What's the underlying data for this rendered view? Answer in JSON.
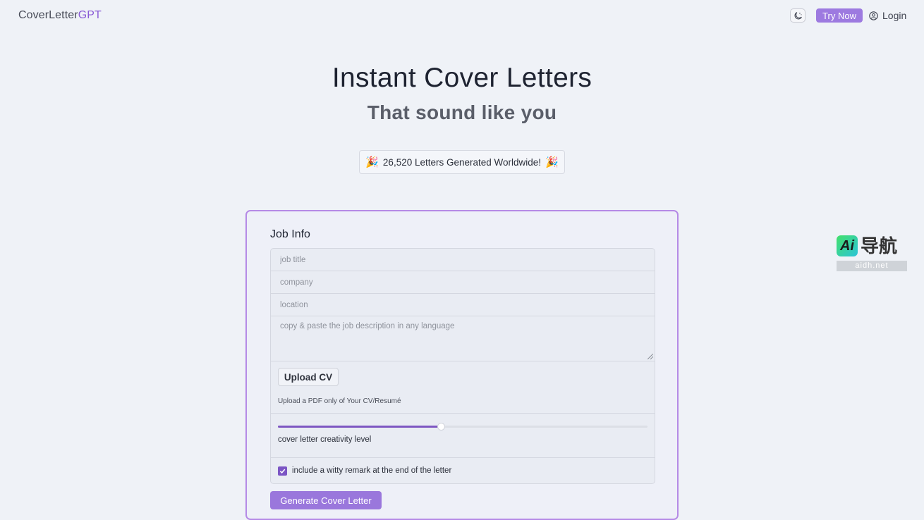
{
  "header": {
    "logo_prefix": "CoverLetter",
    "logo_accent": "GPT",
    "theme_toggle_icon": "moon-stars-icon",
    "try_now_label": "Try Now",
    "login_label": "Login",
    "login_icon": "user-circle-icon"
  },
  "hero": {
    "title": "Instant Cover Letters",
    "subtitle": "That sound like you",
    "counter_text": "26,520 Letters Generated Worldwide!",
    "counter_icon": "party-popper-icon"
  },
  "form": {
    "title": "Job Info",
    "job_title_placeholder": "job title",
    "company_placeholder": "company",
    "location_placeholder": "location",
    "description_placeholder": "copy & paste the job description in any language",
    "upload_label": "Upload CV",
    "upload_hint": "Upload a PDF only of Your CV/Resumé",
    "creativity_label": "cover letter creativity level",
    "creativity_value": 0.44,
    "witty_label": "include a witty remark at the end of the letter",
    "witty_checked": true,
    "generate_label": "Generate Cover Letter"
  },
  "watermark": {
    "logo_text": "Ai",
    "text": "导航",
    "url": "aidh.net"
  },
  "colors": {
    "accent": "#9d7ae0",
    "slider_fill": "#7e57c2",
    "card_border": "#b58ae6",
    "background": "#eff2f7"
  }
}
